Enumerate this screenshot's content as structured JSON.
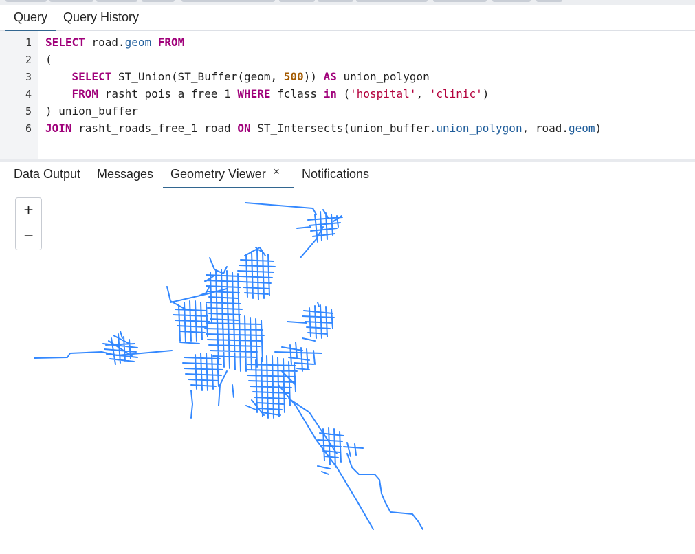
{
  "query_tabs": [
    {
      "label": "Query",
      "active": true
    },
    {
      "label": "Query History",
      "active": false
    }
  ],
  "editor": {
    "line_numbers": [
      "1",
      "2",
      "3",
      "4",
      "5",
      "6"
    ],
    "lines": {
      "l1": {
        "select": "SELECT",
        "t1": " road.",
        "geom": "geom",
        "from": " FROM"
      },
      "l2": {
        "t1": "("
      },
      "l3": {
        "select": "SELECT",
        "t1": " ST_Union(ST_Buffer(geom, ",
        "num": "500",
        "t2": ")) ",
        "as": "AS",
        "t3": " union_polygon"
      },
      "l4": {
        "from": "FROM",
        "t1": " rasht_pois_a_free_1 ",
        "where": "WHERE",
        "t2": " fclass ",
        "in": "in",
        "t3": " (",
        "s1": "'hospital'",
        "t4": ", ",
        "s2": "'clinic'",
        "t5": ")"
      },
      "l5": {
        "t1": ") union_buffer"
      },
      "l6": {
        "join": "JOIN",
        "t1": " rasht_roads_free_1 road ",
        "on": "ON",
        "t2": " ST_Intersects(union_buffer.",
        "c1": "union_polygon",
        "t3": ", road.",
        "c2": "geom",
        "t4": ")"
      }
    }
  },
  "result_tabs": [
    {
      "label": "Data Output",
      "active": false
    },
    {
      "label": "Messages",
      "active": false
    },
    {
      "label": "Geometry Viewer",
      "active": true,
      "closable": true
    },
    {
      "label": "Notifications",
      "active": false
    }
  ],
  "close_symbol": "×",
  "map": {
    "zoom_in": "+",
    "zoom_out": "−",
    "line_color": "#3388ff"
  }
}
